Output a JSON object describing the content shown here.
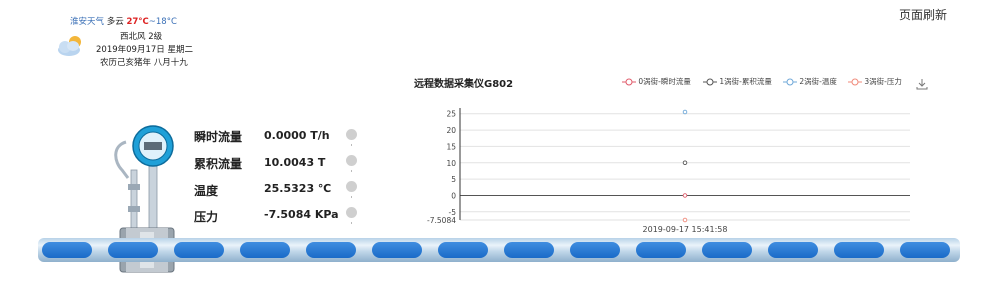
{
  "weather": {
    "city": "淮安天气",
    "condition": "多云",
    "temp_high": "27°C",
    "temp_sep": "~",
    "temp_low": "18°C",
    "wind": "西北风 2级",
    "date": "2019年09月17日 星期二",
    "lunar": "农历己亥猪年 八月十九",
    "icon": "cloudy-sun-icon"
  },
  "refresh_label": "页面刷新",
  "readings": [
    {
      "label": "瞬时流量",
      "value": "0.0000 T/h"
    },
    {
      "label": "累积流量",
      "value": "10.0043 T"
    },
    {
      "label": "温度",
      "value": "25.5323 ℃"
    },
    {
      "label": "压力",
      "value": "-7.5084 KPa"
    }
  ],
  "chart_data": {
    "type": "line",
    "title": "远程数据采集仪G802",
    "x": [
      "2019-09-17 15:41:58"
    ],
    "series": [
      {
        "name": "0涡街-瞬时流量",
        "color": "#e05a6a",
        "values": [
          0.0
        ]
      },
      {
        "name": "1涡街-累积流量",
        "color": "#555555",
        "values": [
          10.0043
        ]
      },
      {
        "name": "2涡街-温度",
        "color": "#6fa8d8",
        "values": [
          25.5323
        ]
      },
      {
        "name": "3涡街-压力",
        "color": "#f08a7a",
        "values": [
          -7.5084
        ]
      }
    ],
    "yticks": [
      "25",
      "20",
      "15",
      "10",
      "5",
      "0",
      "-5",
      "-7.5084"
    ],
    "ylim": [
      -7.5084,
      25.5323
    ],
    "grid": true,
    "legend_position": "top-right"
  }
}
